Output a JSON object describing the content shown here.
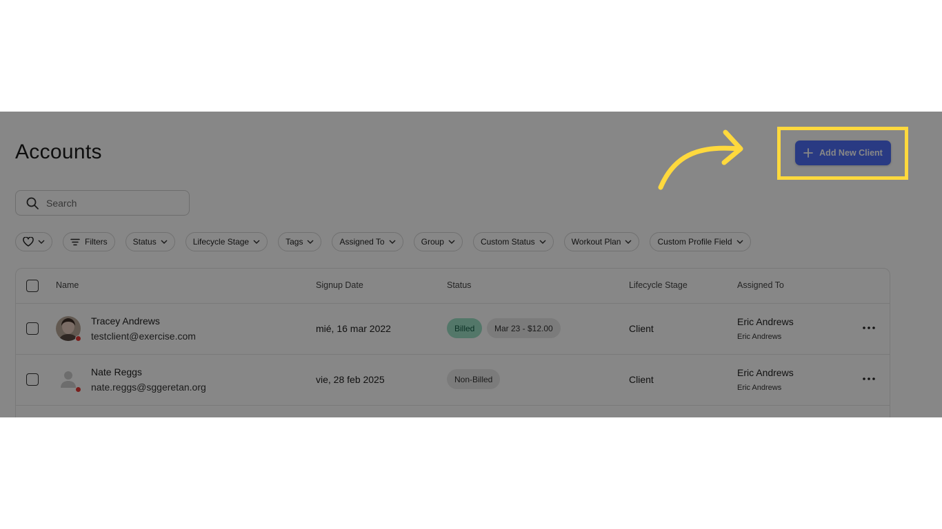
{
  "page": {
    "title": "Accounts"
  },
  "search": {
    "placeholder": "Search"
  },
  "actions": {
    "add_client_label": "Add New Client"
  },
  "filters": {
    "items": [
      "Filters",
      "Status",
      "Lifecycle Stage",
      "Tags",
      "Assigned To",
      "Group",
      "Custom Status",
      "Workout Plan",
      "Custom Profile Field"
    ]
  },
  "table": {
    "headers": {
      "name": "Name",
      "signup_date": "Signup Date",
      "status": "Status",
      "lifecycle_stage": "Lifecycle Stage",
      "assigned_to": "Assigned To"
    },
    "rows": [
      {
        "name": "Tracey Andrews",
        "email": "testclient@exercise.com",
        "signup_date": "mié, 16 mar 2022",
        "status": "Billed",
        "billing": "Mar 23 - $12.00",
        "lifecycle_stage": "Client",
        "assigned_to": "Eric Andrews",
        "assigned_to_sub": "Eric Andrews"
      },
      {
        "name": "Nate Reggs",
        "email": "nate.reggs@sggeretan.org",
        "signup_date": "vie, 28 feb 2025",
        "status": "Non-Billed",
        "lifecycle_stage": "Client",
        "assigned_to": "Eric Andrews",
        "assigned_to_sub": "Eric Andrews"
      }
    ]
  },
  "colors": {
    "primary_button": "#4f6ef7",
    "billed_badge": "#9de0c7",
    "highlight": "#ffd93d",
    "presence_offline": "#e53935"
  }
}
